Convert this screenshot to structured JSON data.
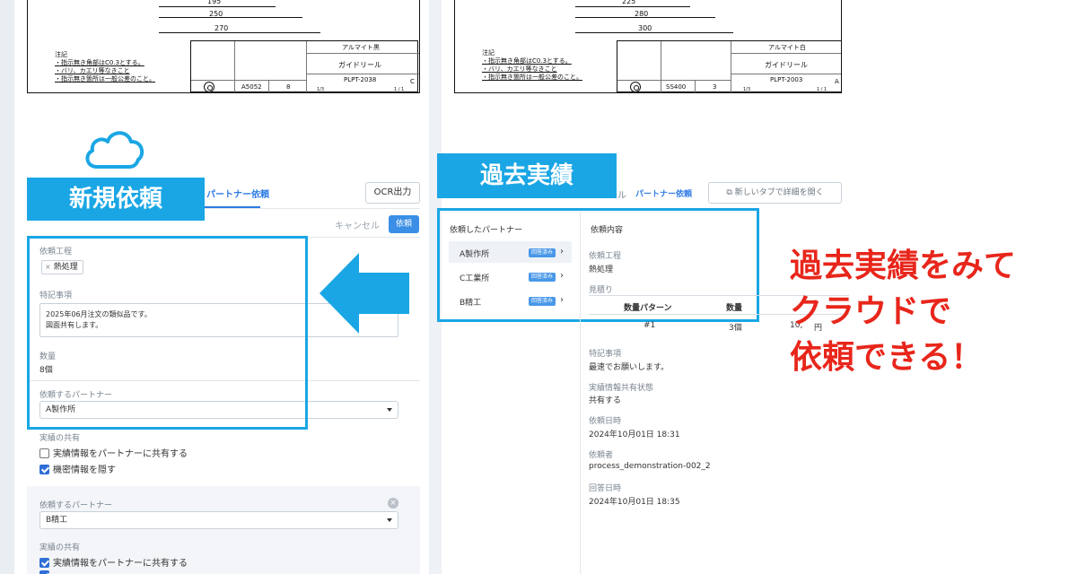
{
  "left_drawing": {
    "dims": [
      "195",
      "250",
      "270"
    ],
    "notes_title": "注記",
    "notes": [
      "・指示無き角部はC0.3とする。",
      "・バリ、カエリ等なきこと",
      "・指示無き箇所は一般公差のこと。"
    ],
    "finish": "アルマイト黒",
    "part_name": "ガイドリール",
    "material": "A5052",
    "qty": "8",
    "drawing_no": "PLPT-2038",
    "rev": "C",
    "scale": "1/3",
    "sheet": "1 / 1"
  },
  "right_drawing": {
    "dims": [
      "225",
      "280",
      "300"
    ],
    "notes_title": "注記",
    "notes": [
      "・指示無き角部はC0.3とする。",
      "・バリ、カエリ等なきこと",
      "・指示無き箇所は一般公差のこと。"
    ],
    "finish": "アルマイト白",
    "part_name": "ガイドリール",
    "material": "SS400",
    "qty": "3",
    "drawing_no": "PLPT-2003",
    "rev": "A",
    "scale": "1/3",
    "sheet": "1 / 1"
  },
  "labels": {
    "new_request": "新規依頼",
    "past_results": "過去実績",
    "headline_lines": [
      "過去実績をみて",
      "クラウドで",
      "依頼できる！"
    ]
  },
  "left_panel": {
    "tab_partner_request": "パートナー依頼",
    "ocr_button": "OCR出力",
    "cancel_button": "キャンセル",
    "request_button": "依頼",
    "process_label": "依頼工程",
    "process_chip": "熱処理",
    "notes_label": "特記事項",
    "notes_lines": [
      "2025年06月注文の類似品です。",
      "図面共有します。"
    ],
    "qty_label": "数量",
    "qty_value": "8個",
    "partner_label": "依頼するパートナー",
    "partner_value": "A製作所",
    "share_label": "実績の共有",
    "share_option1": "実績情報をパートナーに共有する",
    "share_option1_checked": false,
    "share_option2": "機密情報を隠す",
    "share_option2_checked": true,
    "second": {
      "partner_label": "依頼するパートナー",
      "partner_value": "B精工",
      "share_label": "実績の共有",
      "share_option1": "実績情報をパートナーに共有する",
      "share_option1_checked": true
    }
  },
  "right_panel": {
    "tab_partial": "ル",
    "tab_partner_request": "パートナー依頼",
    "open_tab_button": "新しいタブで詳細を開く",
    "partners_header": "依頼したパートナー",
    "partners": [
      {
        "name": "A製作所",
        "badge": "回答済み"
      },
      {
        "name": "C工業所",
        "badge": "回答済み"
      },
      {
        "name": "B精工",
        "badge": "回答済み"
      }
    ],
    "detail_header": "依頼内容",
    "process_label": "依頼工程",
    "process_value": "熱処理",
    "estimate_label": "見積り",
    "table_headers": [
      "数量パターン",
      "数量"
    ],
    "table_row": [
      "#1",
      "3個",
      "10,",
      "円"
    ],
    "notes_label": "特記事項",
    "notes_value": "最速でお願いします。",
    "share_state_label": "実績情報共有状態",
    "share_state_value": "共有する",
    "request_date_label": "依頼日時",
    "request_date_value": "2024年10月01日 18:31",
    "requester_label": "依頼者",
    "requester_value": "process_demonstration-002_2",
    "answer_date_label": "回答日時",
    "answer_date_value": "2024年10月01日 18:35"
  },
  "colors": {
    "label_blue": "#1aa6e4",
    "link_blue": "#2d7be5",
    "headline_red": "#e8261b"
  }
}
